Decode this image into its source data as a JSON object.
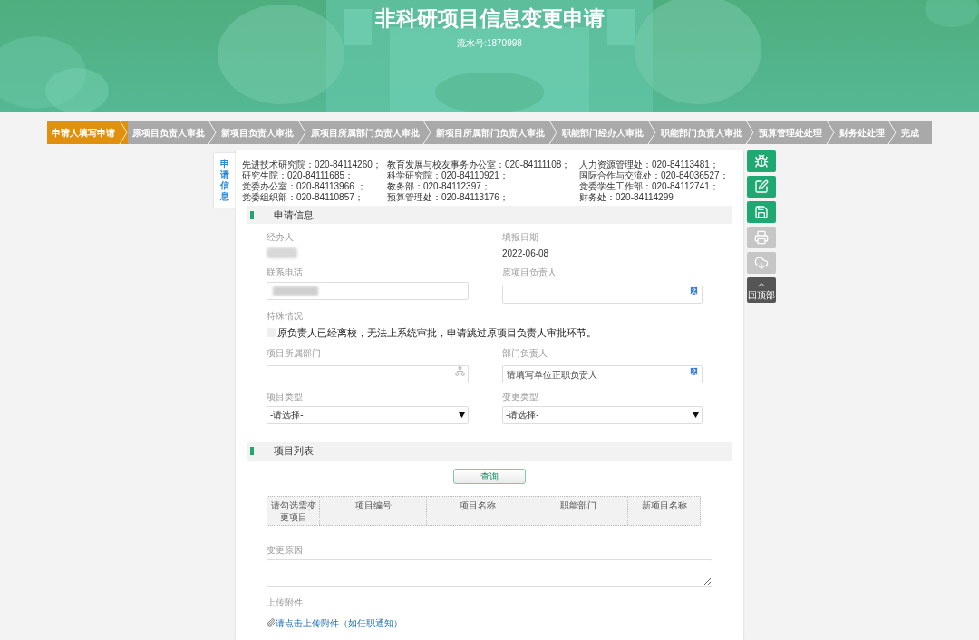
{
  "header": {
    "title": "非科研项目信息变更申请",
    "serial": "流水号:1870998"
  },
  "steps": [
    {
      "label": "申请人填写申请",
      "selected": true
    },
    {
      "label": "原项目负责人审批",
      "selected": false
    },
    {
      "label": "新项目负责人审批",
      "selected": false
    },
    {
      "label": "原项目所属部门负责人审批",
      "selected": false
    },
    {
      "label": "新项目所属部门负责人审批",
      "selected": false
    },
    {
      "label": "职能部门经办人审批",
      "selected": false
    },
    {
      "label": "职能部门负责人审批",
      "selected": false
    },
    {
      "label": "预算管理处处理",
      "selected": false
    },
    {
      "label": "财务处处理",
      "selected": false
    },
    {
      "label": "完成",
      "selected": false
    }
  ],
  "side_tab": "申请信息",
  "contacts": [
    "先进技术研究院：020-84114260；",
    "教育发展与校友事务办公室：020-84111108；",
    "人力资源管理处：020-84113481；",
    "研究生院：020-84111685；",
    "科学研究院：020-84110921；",
    "国际合作与交流处：020-84036527；",
    "党委办公室：020-84113966 ；",
    "教务部：020-84112397；",
    "党委学生工作部：020-84112741；",
    "党委组织部：020-84110857；",
    "预算管理处：020-84113176；",
    "财务处：020-84114299"
  ],
  "application": {
    "title": "申请信息",
    "fields": [
      {
        "kind": "static",
        "label": "经办人",
        "redacted": true
      },
      {
        "kind": "static",
        "label": "填报日期",
        "value": "2022-06-08",
        "redacted": false
      },
      {
        "kind": "input",
        "label": "联系电话",
        "redacted": true
      },
      {
        "kind": "person_picker",
        "label": "原项目负责人"
      },
      {
        "kind": "checkbox",
        "label": "特殊情况",
        "text": "原负责人已经离校，无法上系统审批，申请跳过原项目负责人审批环节。",
        "checked": false
      },
      {
        "kind": "org_picker",
        "label": "项目所属部门"
      },
      {
        "kind": "person_picker",
        "label": "部门负责人",
        "placeholder": "请填写单位正职负责人"
      },
      {
        "kind": "select",
        "label": "项目类型",
        "value": "-请选择-"
      },
      {
        "kind": "select",
        "label": "变更类型",
        "value": "-请选择-"
      }
    ]
  },
  "projects": {
    "title": "项目列表",
    "query_button": "查询",
    "columns": [
      "请勾选需变更项目",
      "项目编号",
      "项目名称",
      "职能部门",
      "新项目名称"
    ],
    "reason_label": "变更原因",
    "upload_label": "上传附件",
    "upload_link": "请点击上传附件（如任职通知）"
  },
  "toolbar": [
    {
      "kind": "bug",
      "disabled": false
    },
    {
      "kind": "edit",
      "disabled": false
    },
    {
      "kind": "save",
      "disabled": false
    },
    {
      "kind": "print",
      "disabled": true
    },
    {
      "kind": "cloud",
      "disabled": true
    },
    {
      "kind": "top",
      "label": "回顶部",
      "disabled": false
    }
  ]
}
